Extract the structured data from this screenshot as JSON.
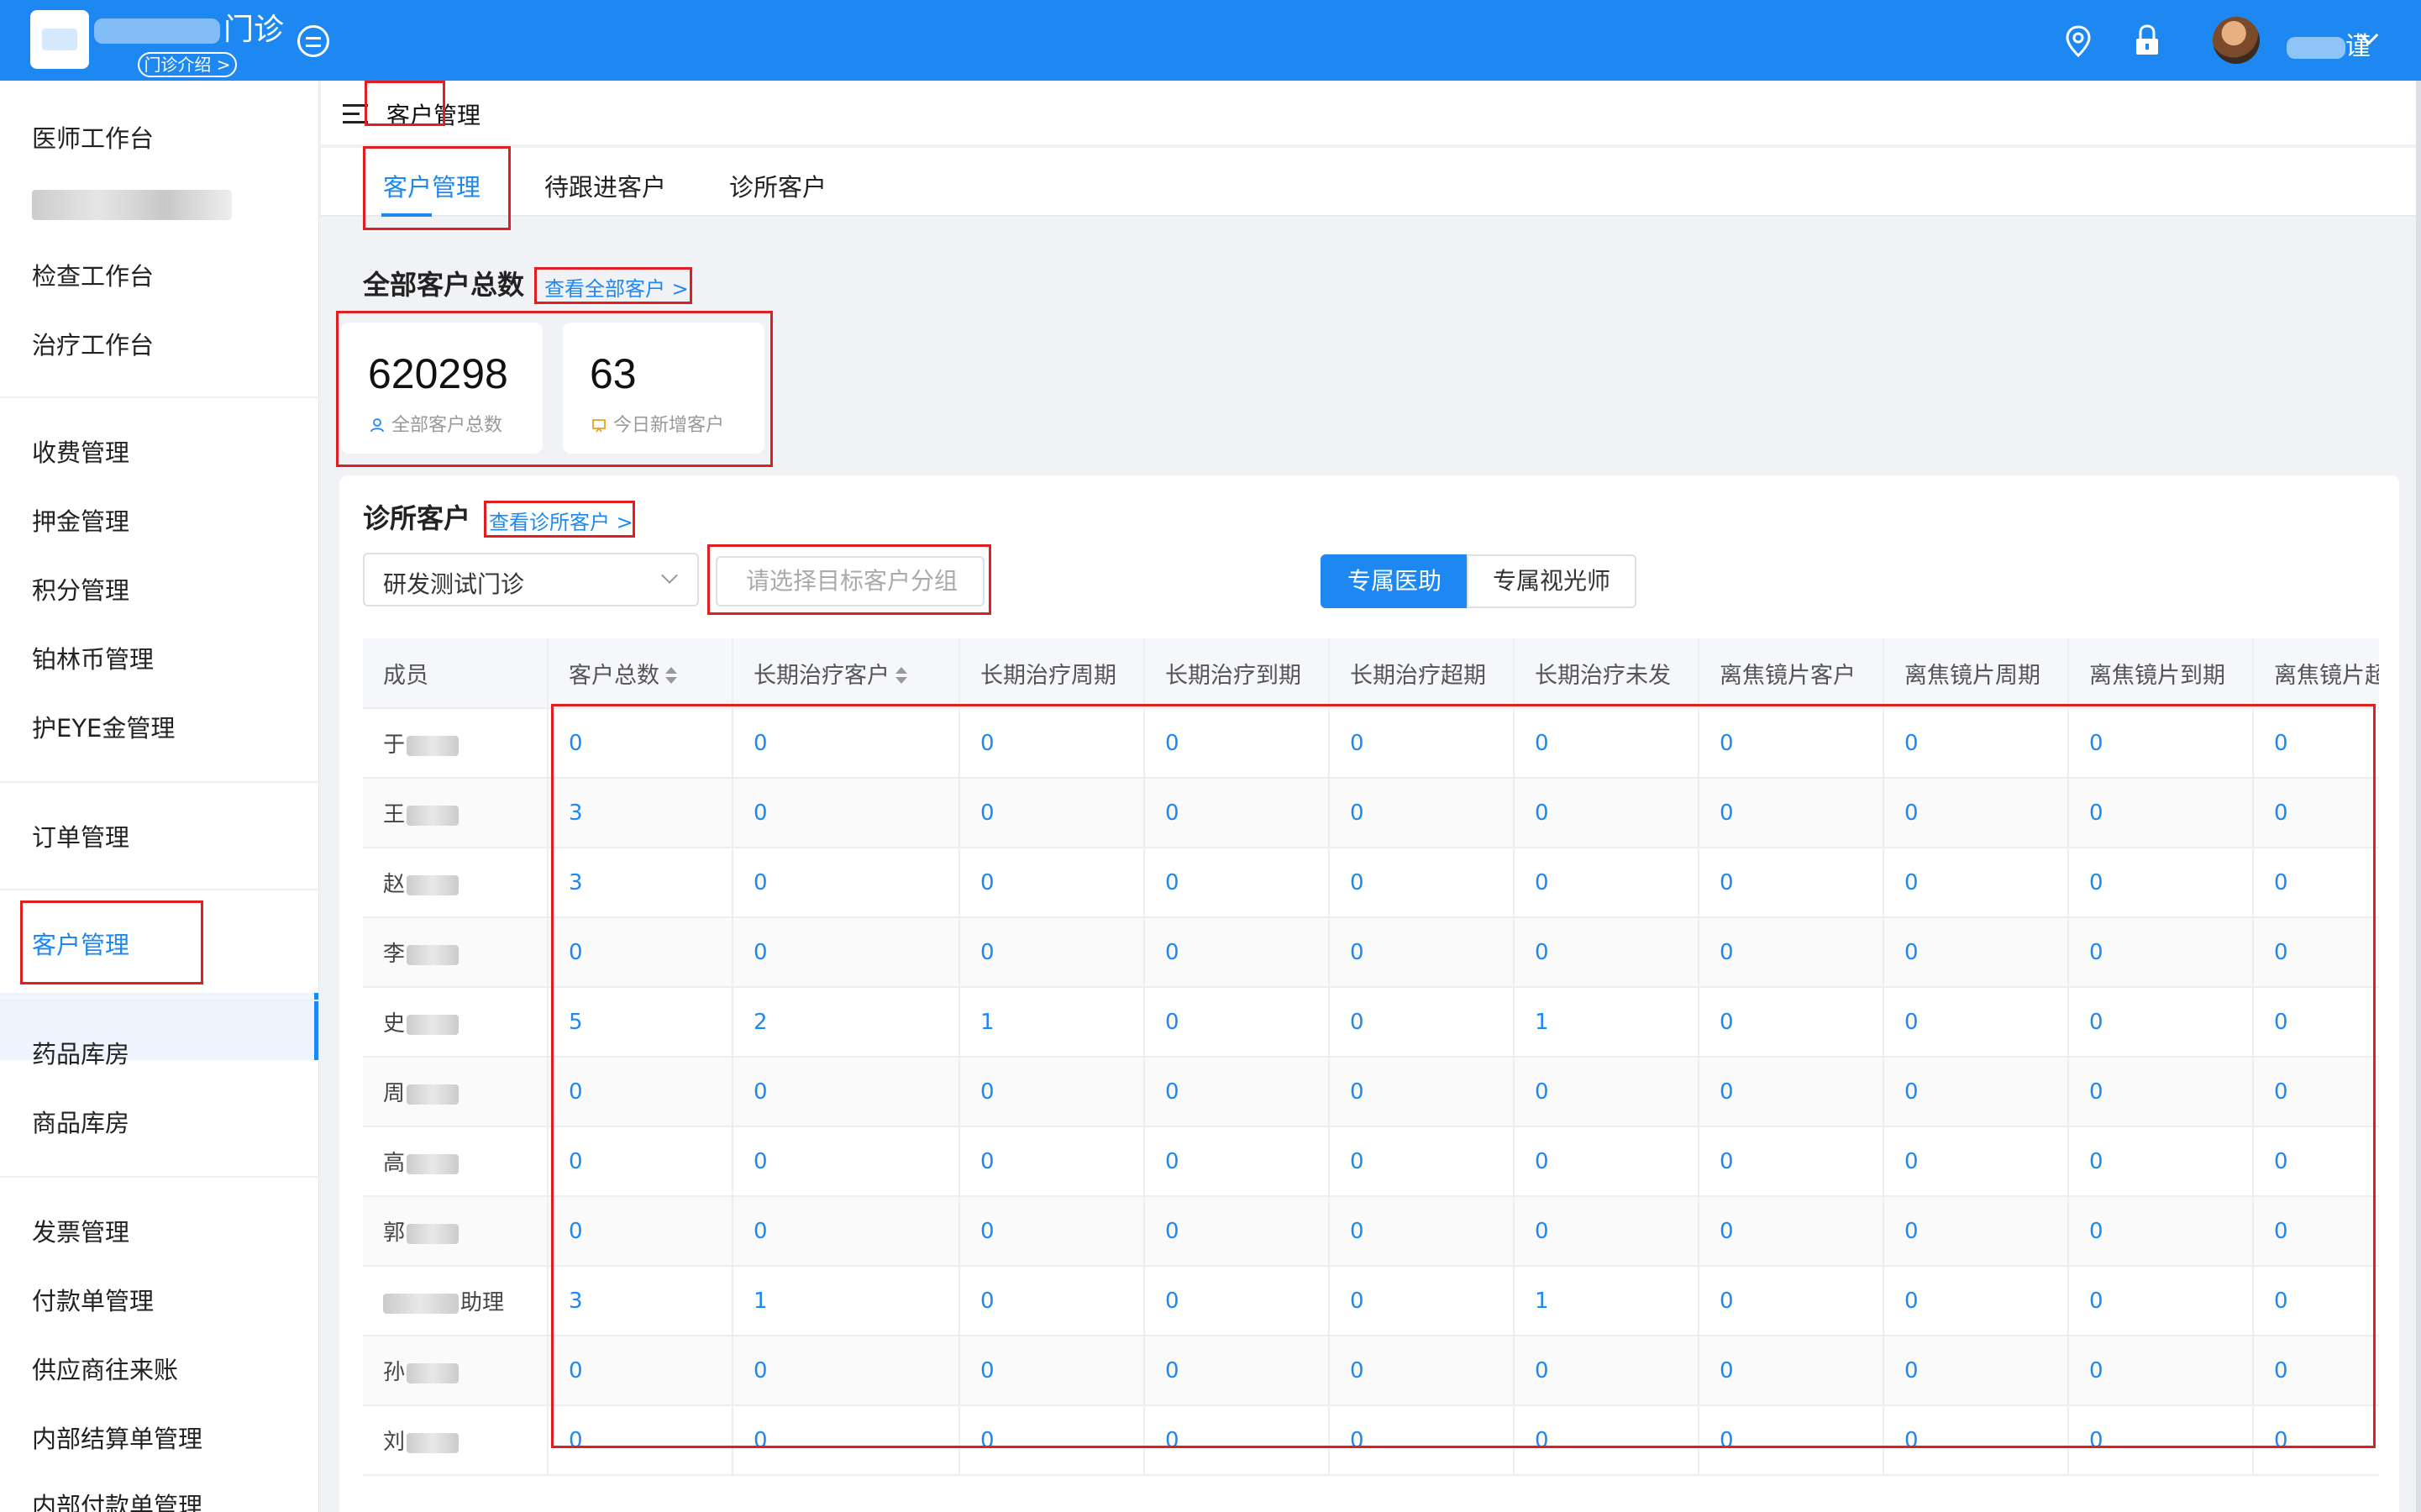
{
  "header": {
    "clinic_name": "门诊",
    "intro_button": "门诊介绍 >",
    "user_name": "谨"
  },
  "colors": {
    "primary": "#1e88f2",
    "highlight": "#e02020"
  },
  "sidebar": {
    "items": [
      {
        "label": "医师工作台"
      },
      {
        "label": "检查工作台"
      },
      {
        "label": "治疗工作台"
      },
      {
        "label": "收费管理"
      },
      {
        "label": "押金管理"
      },
      {
        "label": "积分管理"
      },
      {
        "label": "铂林币管理"
      },
      {
        "label": "护EYE金管理"
      },
      {
        "label": "订单管理"
      },
      {
        "label": "客户管理",
        "active": true
      },
      {
        "label": "药品库房"
      },
      {
        "label": "商品库房"
      },
      {
        "label": "发票管理"
      },
      {
        "label": "付款单管理"
      },
      {
        "label": "供应商往来账"
      },
      {
        "label": "内部结算单管理"
      },
      {
        "label": "内部付款单管理"
      }
    ]
  },
  "breadcrumb": {
    "title": "客户管理"
  },
  "tabs": [
    {
      "label": "客户管理",
      "active": true
    },
    {
      "label": "待跟进客户"
    },
    {
      "label": "诊所客户"
    }
  ],
  "summary": {
    "title": "全部客户总数",
    "link": "查看全部客户 >",
    "cards": [
      {
        "value": "620298",
        "label": "全部客户总数",
        "icon": "user-icon"
      },
      {
        "value": "63",
        "label": "今日新增客户",
        "icon": "new-customer-icon"
      }
    ]
  },
  "clinic": {
    "title": "诊所客户",
    "link": "查看诊所客户 >",
    "clinic_select": "研发测试门诊",
    "group_placeholder": "请选择目标客户分组",
    "seg_active": "专属医助",
    "seg_inactive": "专属视光师"
  },
  "table": {
    "columns": [
      "成员",
      "客户总数",
      "长期治疗客户",
      "长期治疗周期",
      "长期治疗到期",
      "长期治疗超期",
      "长期治疗未发",
      "离焦镜片客户",
      "离焦镜片周期",
      "离焦镜片到期",
      "离焦镜片超"
    ],
    "rows": [
      {
        "member": "于",
        "values": [
          "0",
          "0",
          "0",
          "0",
          "0",
          "0",
          "0",
          "0",
          "0",
          "0"
        ]
      },
      {
        "member": "王",
        "values": [
          "3",
          "0",
          "0",
          "0",
          "0",
          "0",
          "0",
          "0",
          "0",
          "0"
        ]
      },
      {
        "member": "赵",
        "values": [
          "3",
          "0",
          "0",
          "0",
          "0",
          "0",
          "0",
          "0",
          "0",
          "0"
        ]
      },
      {
        "member": "李",
        "values": [
          "0",
          "0",
          "0",
          "0",
          "0",
          "0",
          "0",
          "0",
          "0",
          "0"
        ]
      },
      {
        "member": "史",
        "values": [
          "5",
          "2",
          "1",
          "0",
          "0",
          "1",
          "0",
          "0",
          "0",
          "0"
        ]
      },
      {
        "member": "周",
        "values": [
          "0",
          "0",
          "0",
          "0",
          "0",
          "0",
          "0",
          "0",
          "0",
          "0"
        ]
      },
      {
        "member": "高",
        "values": [
          "0",
          "0",
          "0",
          "0",
          "0",
          "0",
          "0",
          "0",
          "0",
          "0"
        ]
      },
      {
        "member": "郭",
        "values": [
          "0",
          "0",
          "0",
          "0",
          "0",
          "0",
          "0",
          "0",
          "0",
          "0"
        ]
      },
      {
        "member": "助理",
        "values": [
          "3",
          "1",
          "0",
          "0",
          "0",
          "1",
          "0",
          "0",
          "0",
          "0"
        ]
      },
      {
        "member": "孙",
        "values": [
          "0",
          "0",
          "0",
          "0",
          "0",
          "0",
          "0",
          "0",
          "0",
          "0"
        ]
      },
      {
        "member": "刘",
        "values": [
          "0",
          "0",
          "0",
          "0",
          "0",
          "0",
          "0",
          "0",
          "0",
          "0"
        ]
      }
    ]
  }
}
